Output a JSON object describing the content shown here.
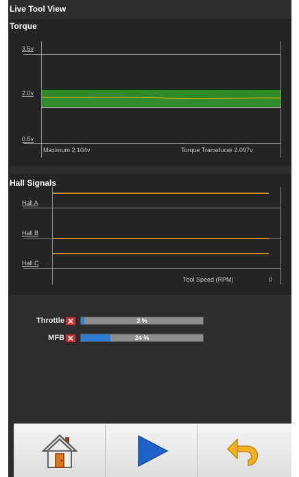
{
  "window": {
    "title": "Live Tool View"
  },
  "torque": {
    "title": "Torque",
    "y_labels": [
      "3.5v",
      "2.0v",
      "0.5v"
    ],
    "max_label": "Maximum 2.104v",
    "transducer_label": "Torque Transducer 2.097v",
    "band_color": "#2f8a2a",
    "trace_color": "#d9b000"
  },
  "hall": {
    "title": "Hall Signals",
    "labels": [
      "Hall A",
      "Hall B",
      "Hall C"
    ],
    "speed_label": "Tool Speed (RPM)",
    "speed_value": "0",
    "signal_color": "#c08a1a"
  },
  "controls": {
    "throttle": {
      "label": "Throttle",
      "value_text": "3 %",
      "fraction": 0.03
    },
    "mfb": {
      "label": "MFB",
      "value_text": "24 %",
      "fraction": 0.24
    },
    "fill_color": "#2d7fd6"
  },
  "toolbar": {
    "home_icon": "home-icon",
    "play_icon": "play-icon",
    "back_icon": "undo-arrow-icon"
  }
}
